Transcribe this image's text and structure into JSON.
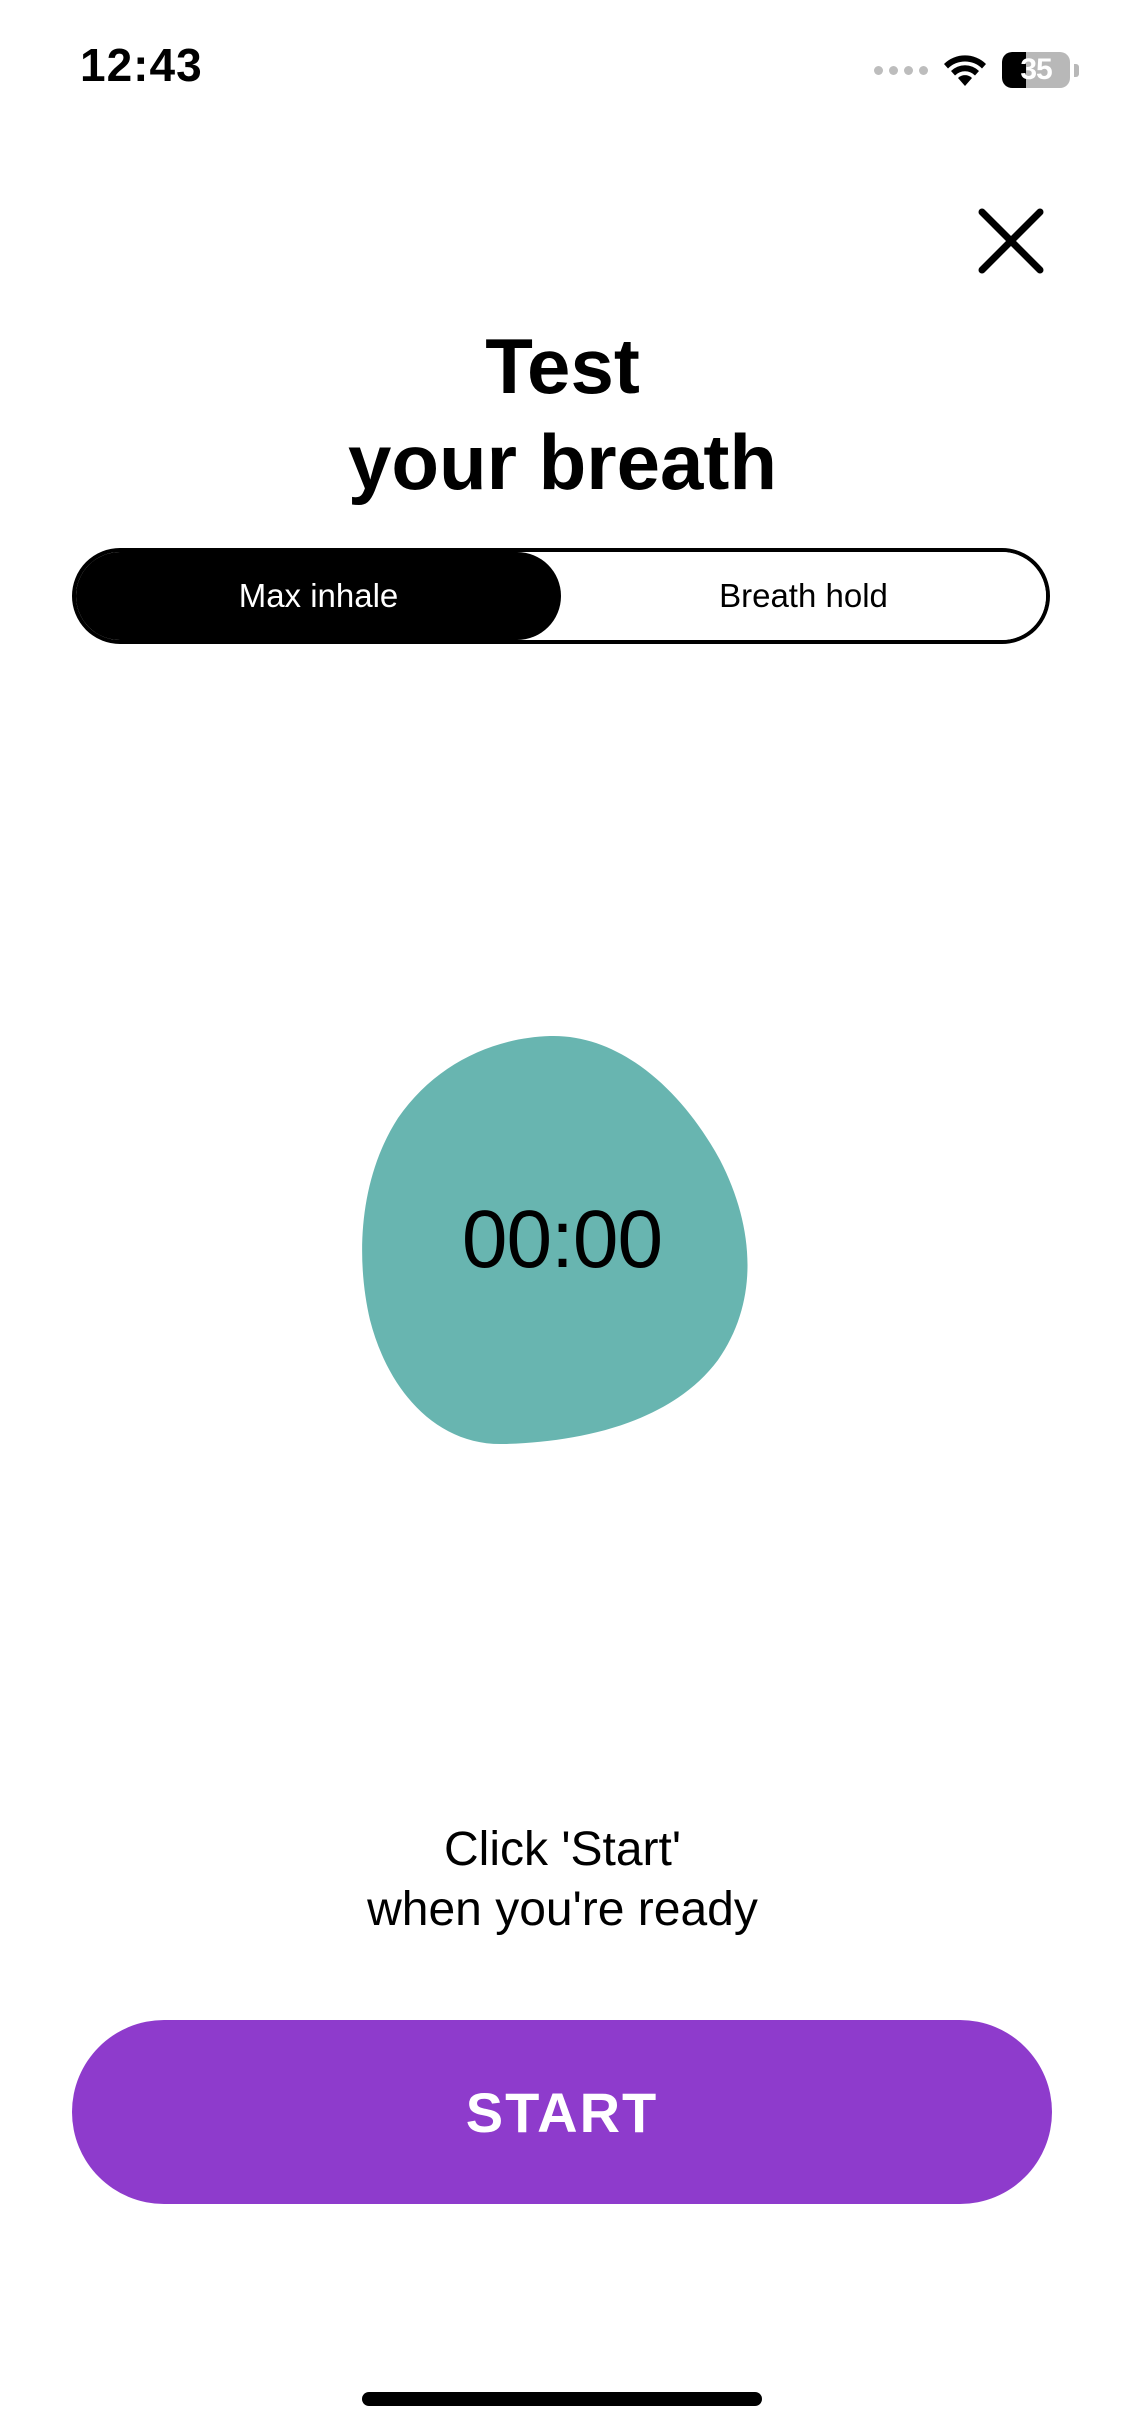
{
  "status_bar": {
    "time": "12:43",
    "battery_percent": "35",
    "battery_level": 0.35,
    "signal_icon": "signal-dots-icon",
    "wifi_icon": "wifi-icon"
  },
  "header": {
    "close_icon": "close-icon",
    "title_line1": "Test",
    "title_line2": "your breath"
  },
  "mode_selector": {
    "options": [
      {
        "label": "Max inhale",
        "selected": true
      },
      {
        "label": "Breath hold",
        "selected": false
      }
    ]
  },
  "timer": {
    "value": "00:00",
    "blob_color": "#68b5b0"
  },
  "instructions": {
    "line1": "Click 'Start'",
    "line2": "when you're ready"
  },
  "start_button": {
    "label": "START",
    "color": "#8e3bcc"
  }
}
